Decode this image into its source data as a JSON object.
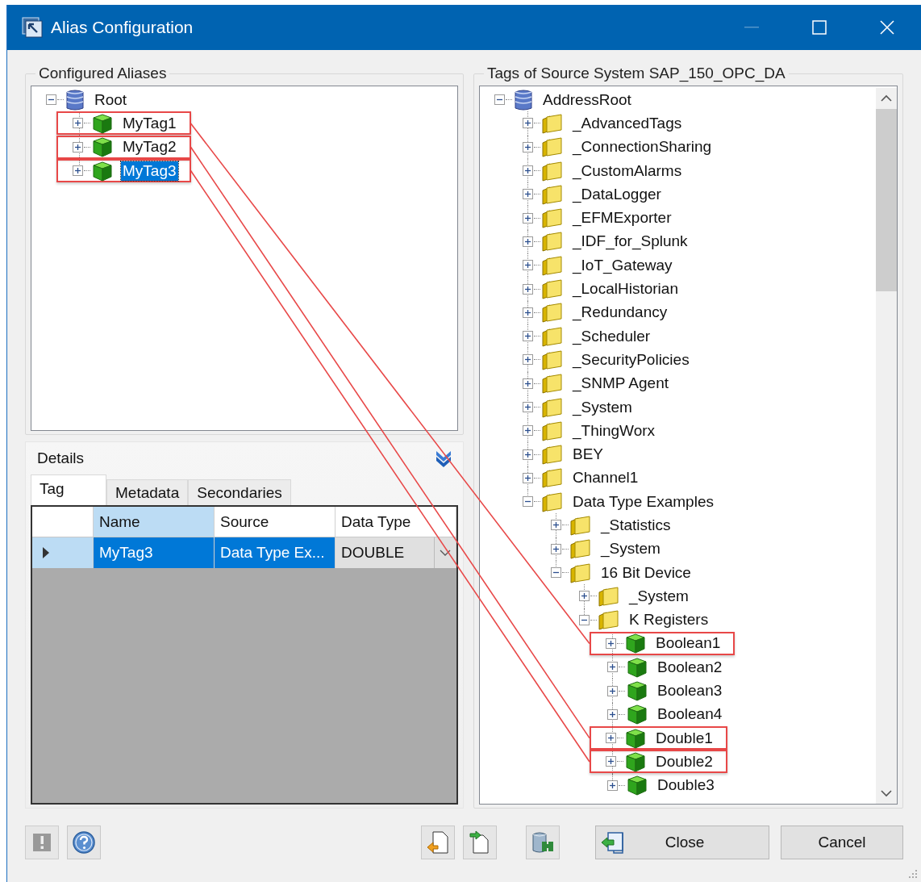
{
  "window": {
    "title": "Alias Configuration",
    "minimize_disabled": true
  },
  "aliases": {
    "title": "Configured Aliases",
    "tree": [
      {
        "label": "Root",
        "kind": "database",
        "expanded": true,
        "selected": false,
        "highlighted": false,
        "children": [
          {
            "label": "MyTag1",
            "kind": "tag",
            "expanded": false,
            "selected": false,
            "highlighted": true
          },
          {
            "label": "MyTag2",
            "kind": "tag",
            "expanded": false,
            "selected": false,
            "highlighted": true
          },
          {
            "label": "MyTag3",
            "kind": "tag",
            "expanded": false,
            "selected": true,
            "highlighted": true
          }
        ]
      }
    ]
  },
  "details": {
    "title": "Details",
    "tabs": [
      {
        "label": "Tag",
        "selected": true
      },
      {
        "label": "Metadata",
        "selected": false
      },
      {
        "label": "Secondaries",
        "selected": false
      }
    ],
    "columns": [
      {
        "label": "Name",
        "kind": "text",
        "highlighted": true
      },
      {
        "label": "Source",
        "kind": "text",
        "highlighted": false
      },
      {
        "label": "Data Type",
        "kind": "combo",
        "highlighted": false
      }
    ],
    "rows": [
      {
        "selected": true,
        "cells": [
          "MyTag3",
          "Data Type Ex...",
          "DOUBLE"
        ]
      }
    ]
  },
  "source": {
    "title": "Tags of Source System SAP_150_OPC_DA",
    "tree": [
      {
        "label": "AddressRoot",
        "kind": "database",
        "expanded": true,
        "selected": false,
        "highlighted": false,
        "children": [
          {
            "label": "_AdvancedTags",
            "kind": "folder",
            "expanded": false,
            "selected": false,
            "highlighted": false
          },
          {
            "label": "_ConnectionSharing",
            "kind": "folder",
            "expanded": false,
            "selected": false,
            "highlighted": false
          },
          {
            "label": "_CustomAlarms",
            "kind": "folder",
            "expanded": false,
            "selected": false,
            "highlighted": false
          },
          {
            "label": "_DataLogger",
            "kind": "folder",
            "expanded": false,
            "selected": false,
            "highlighted": false
          },
          {
            "label": "_EFMExporter",
            "kind": "folder",
            "expanded": false,
            "selected": false,
            "highlighted": false
          },
          {
            "label": "_IDF_for_Splunk",
            "kind": "folder",
            "expanded": false,
            "selected": false,
            "highlighted": false
          },
          {
            "label": "_IoT_Gateway",
            "kind": "folder",
            "expanded": false,
            "selected": false,
            "highlighted": false
          },
          {
            "label": "_LocalHistorian",
            "kind": "folder",
            "expanded": false,
            "selected": false,
            "highlighted": false
          },
          {
            "label": "_Redundancy",
            "kind": "folder",
            "expanded": false,
            "selected": false,
            "highlighted": false
          },
          {
            "label": "_Scheduler",
            "kind": "folder",
            "expanded": false,
            "selected": false,
            "highlighted": false
          },
          {
            "label": "_SecurityPolicies",
            "kind": "folder",
            "expanded": false,
            "selected": false,
            "highlighted": false
          },
          {
            "label": "_SNMP Agent",
            "kind": "folder",
            "expanded": false,
            "selected": false,
            "highlighted": false
          },
          {
            "label": "_System",
            "kind": "folder",
            "expanded": false,
            "selected": false,
            "highlighted": false
          },
          {
            "label": "_ThingWorx",
            "kind": "folder",
            "expanded": false,
            "selected": false,
            "highlighted": false
          },
          {
            "label": "BEY",
            "kind": "folder",
            "expanded": false,
            "selected": false,
            "highlighted": false
          },
          {
            "label": "Channel1",
            "kind": "folder",
            "expanded": false,
            "selected": false,
            "highlighted": false
          },
          {
            "label": "Data Type Examples",
            "kind": "folder",
            "expanded": true,
            "selected": false,
            "highlighted": false,
            "children": [
              {
                "label": "_Statistics",
                "kind": "folder",
                "expanded": false,
                "selected": false,
                "highlighted": false
              },
              {
                "label": "_System",
                "kind": "folder",
                "expanded": false,
                "selected": false,
                "highlighted": false
              },
              {
                "label": "16 Bit Device",
                "kind": "folder",
                "expanded": true,
                "selected": false,
                "highlighted": false,
                "children": [
                  {
                    "label": "_System",
                    "kind": "folder",
                    "expanded": false,
                    "selected": false,
                    "highlighted": false
                  },
                  {
                    "label": "K Registers",
                    "kind": "folder",
                    "expanded": true,
                    "selected": false,
                    "highlighted": false,
                    "children": [
                      {
                        "label": "Boolean1",
                        "kind": "tag",
                        "expanded": false,
                        "selected": false,
                        "highlighted": true
                      },
                      {
                        "label": "Boolean2",
                        "kind": "tag",
                        "expanded": false,
                        "selected": false,
                        "highlighted": false
                      },
                      {
                        "label": "Boolean3",
                        "kind": "tag",
                        "expanded": false,
                        "selected": false,
                        "highlighted": false
                      },
                      {
                        "label": "Boolean4",
                        "kind": "tag",
                        "expanded": false,
                        "selected": false,
                        "highlighted": false
                      },
                      {
                        "label": "Double1",
                        "kind": "tag",
                        "expanded": false,
                        "selected": false,
                        "highlighted": true
                      },
                      {
                        "label": "Double2",
                        "kind": "tag",
                        "expanded": false,
                        "selected": false,
                        "highlighted": true
                      },
                      {
                        "label": "Double3",
                        "kind": "tag",
                        "expanded": false,
                        "selected": false,
                        "highlighted": false
                      }
                    ]
                  }
                ]
              }
            ]
          }
        ]
      }
    ]
  },
  "footer": {
    "buttons": [
      {
        "label": "Close",
        "kind": "icon-text"
      },
      {
        "label": "Cancel",
        "kind": "text"
      }
    ]
  }
}
